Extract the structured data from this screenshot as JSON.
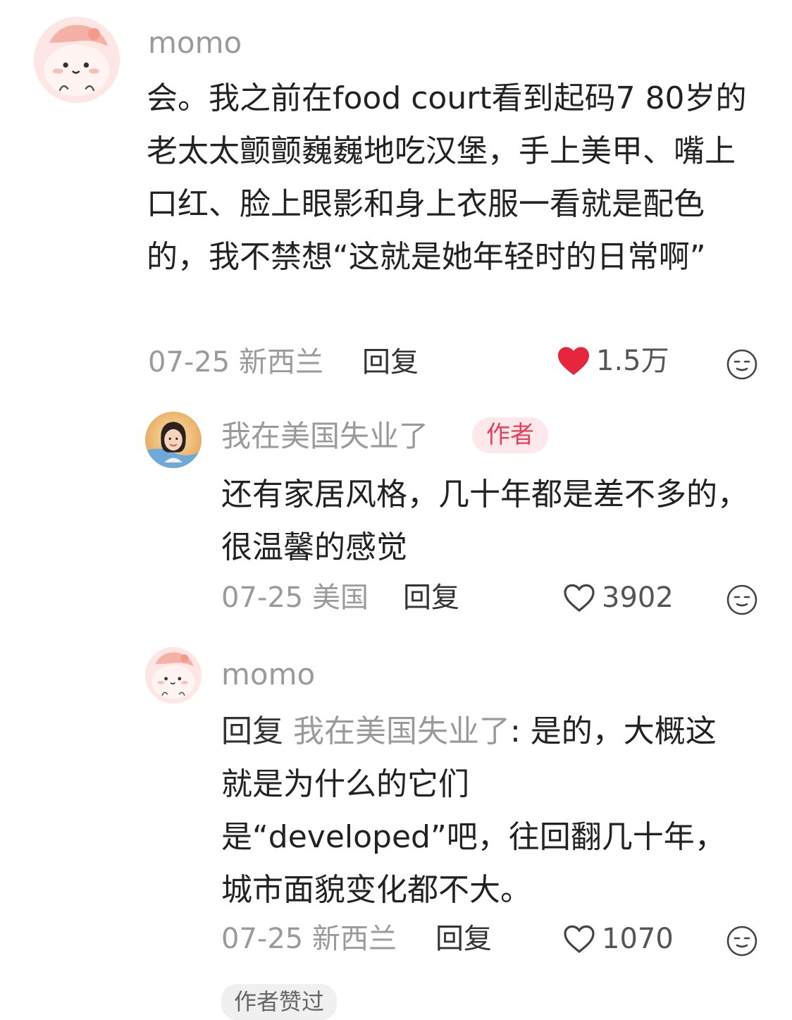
{
  "comments": [
    {
      "username": "momo",
      "avatar_icon": "cute-dumpling-avatar-icon",
      "text": "会。我之前在food court看到起码7 80岁的老太太颤颤巍巍地吃汉堡，手上美甲、嘴上口红、脸上眼影和身上衣服一看就是配色的，我不禁想“这就是她年轻时的日常啊”",
      "date": "07-25",
      "location": "新西兰",
      "reply_label": "回复",
      "likes": "1.5万",
      "liked": true
    },
    {
      "username": "我在美国失业了",
      "avatar_icon": "woman-portrait-avatar-icon",
      "author_badge": "作者",
      "text": "还有家居风格，几十年都是差不多的，很温馨的感觉",
      "date": "07-25",
      "location": "美国",
      "reply_label": "回复",
      "likes": "3902",
      "liked": false
    },
    {
      "username": "momo",
      "avatar_icon": "cute-dumpling-avatar-icon",
      "reply_prefix": "回复",
      "reply_target": "我在美国失业了",
      "text": ": 是的，大概这就是为什么的它们是“developed”吧，往回翻几十年，城市面貌变化都不大。",
      "date": "07-25",
      "location": "新西兰",
      "reply_label": "回复",
      "likes": "1070",
      "liked": false,
      "author_liked_tag": "作者赞过"
    }
  ],
  "colors": {
    "liked_heart": "#e8253f",
    "badge_text": "#e8405b",
    "badge_bg": "#fde8ec",
    "muted_text": "#9a9a9a"
  }
}
